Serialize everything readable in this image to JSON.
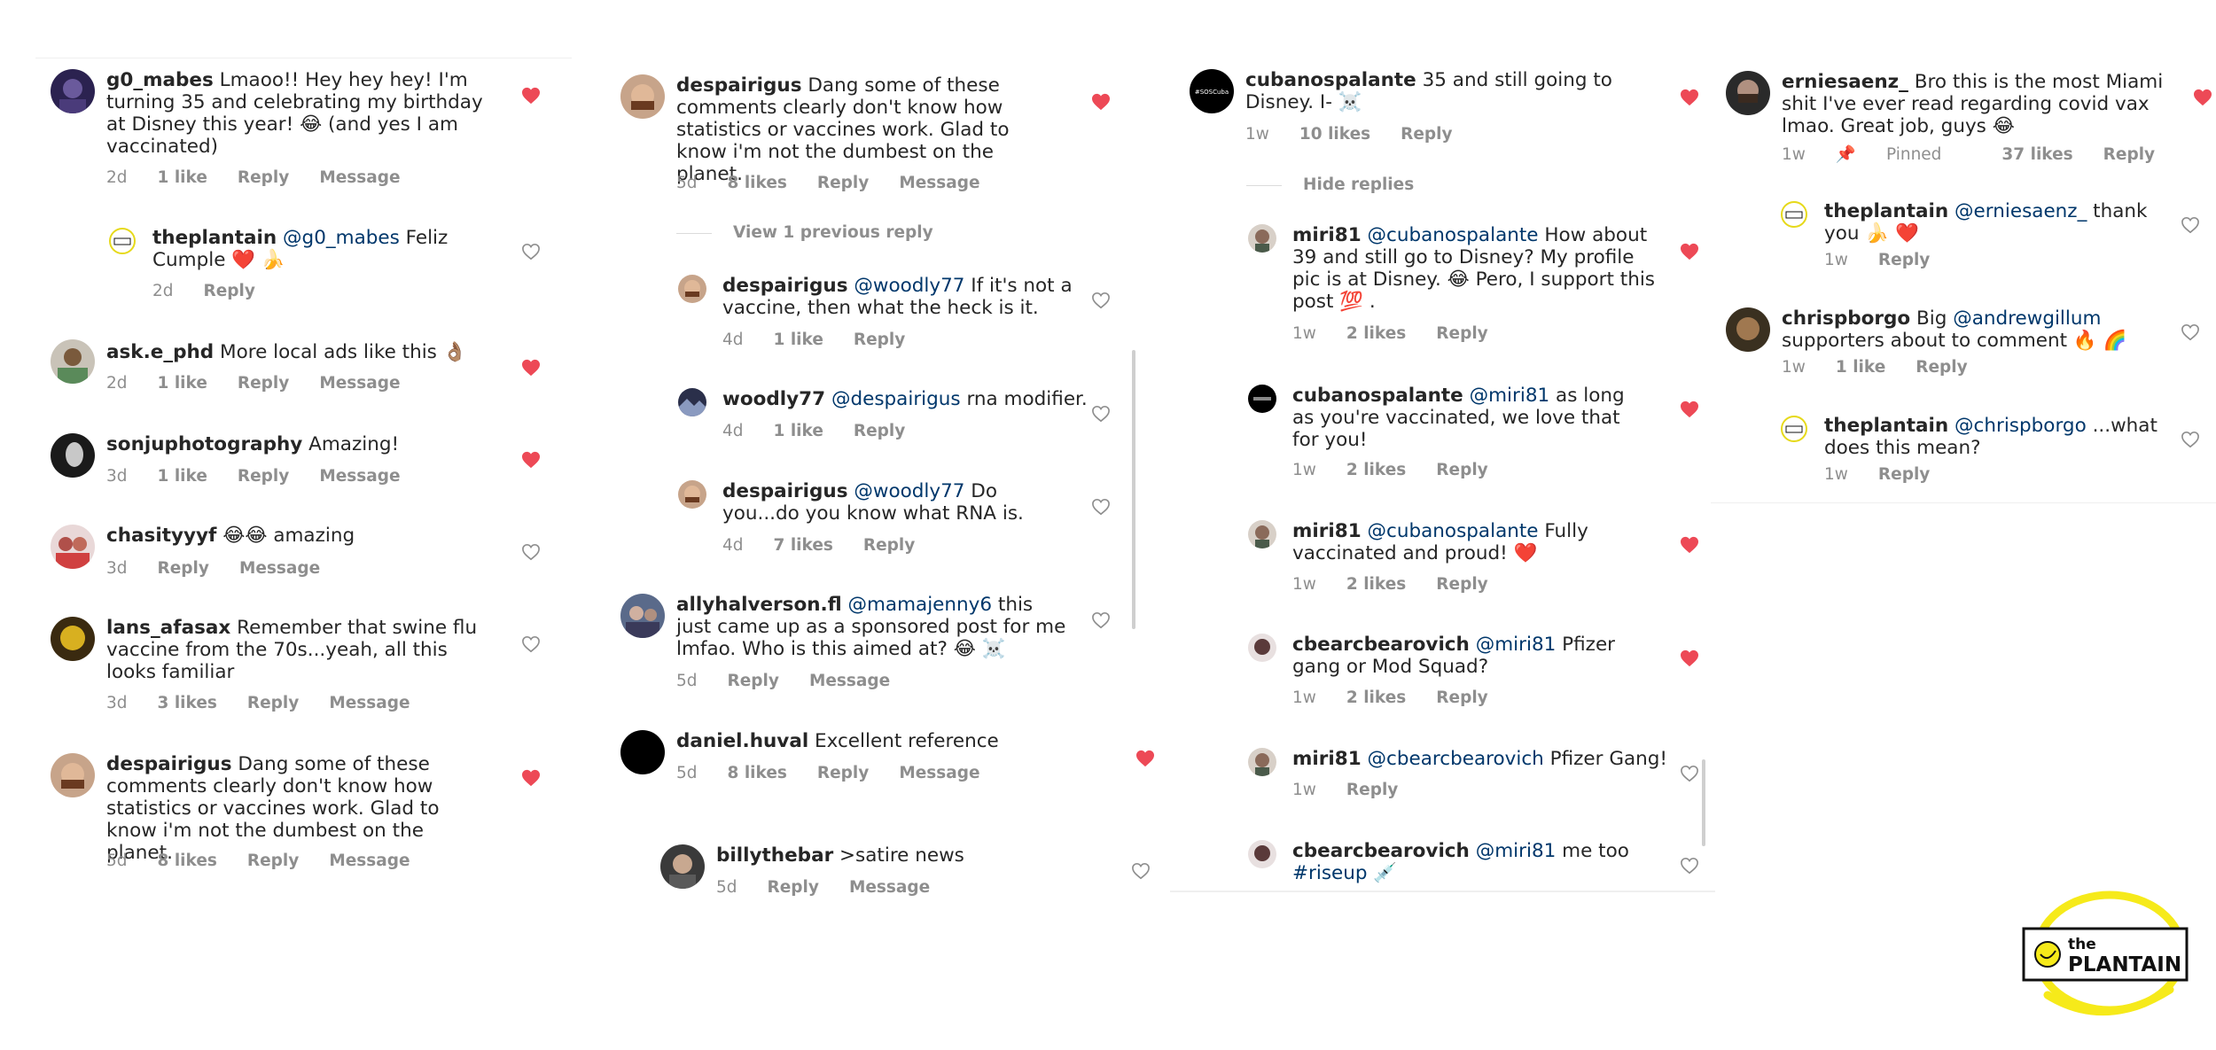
{
  "colors": {
    "heart_liked": "#ed4956",
    "mention": "#00376b",
    "meta": "#8e8e8e",
    "logo_yellow": "#f6ea1a"
  },
  "col1": {
    "c1": {
      "user": "g0_mabes",
      "text": " Lmaoo!! Hey hey hey! I'm turning 35 and celebrating my birthday at Disney this year! 😂 (and yes I am vaccinated)",
      "time": "2d",
      "likes": "1 like",
      "reply": "Reply",
      "message": "Message"
    },
    "c1r": {
      "user": "theplantain",
      "mention": "@g0_mabes",
      "text": " Feliz Cumple ❤️ 🍌",
      "time": "2d",
      "reply": "Reply"
    },
    "c2": {
      "user": "ask.e_phd",
      "text": " More local ads like this 👌🏽",
      "time": "2d",
      "likes": "1 like",
      "reply": "Reply",
      "message": "Message"
    },
    "c3": {
      "user": "sonjuphotography",
      "text": " Amazing!",
      "time": "3d",
      "likes": "1 like",
      "reply": "Reply",
      "message": "Message"
    },
    "c4": {
      "user": "chasityyyf",
      "text": " 😂😂 amazing",
      "time": "3d",
      "reply": "Reply",
      "message": "Message"
    },
    "c5": {
      "user": "lans_afasax",
      "text": " Remember that swine flu vaccine from the 70s...yeah, all this looks familiar",
      "time": "3d",
      "likes": "3 likes",
      "reply": "Reply",
      "message": "Message"
    },
    "c6": {
      "user": "despairigus",
      "text": " Dang some of these comments clearly don't know how statistics or vaccines work. Glad to know i'm not the dumbest on the planet.",
      "time": "5d",
      "likes": "8 likes",
      "reply": "Reply",
      "message": "Message"
    }
  },
  "col2": {
    "c1": {
      "user": "despairigus",
      "text": " Dang some of these comments clearly don't know how statistics or vaccines work. Glad to know i'm not the dumbest on the planet.",
      "time": "5d",
      "likes": "8 likes",
      "reply": "Reply",
      "message": "Message"
    },
    "view_prev": "View 1 previous reply",
    "r1": {
      "user": "despairigus",
      "mention": "@woodly77",
      "text": " If it's not a vaccine, then what the heck is it.",
      "time": "4d",
      "likes": "1 like",
      "reply": "Reply"
    },
    "r2": {
      "user": "woodly77",
      "mention": "@despairigus",
      "text": " rna modifier.",
      "time": "4d",
      "likes": "1 like",
      "reply": "Reply"
    },
    "r3": {
      "user": "despairigus",
      "mention": "@woodly77",
      "text": " Do you...do you know what RNA is.",
      "time": "4d",
      "likes": "7 likes",
      "reply": "Reply"
    },
    "c2": {
      "user": "allyhalverson.fl",
      "mention": "@mamajenny6",
      "text": " this just came up as a sponsored post for me lmfao. Who is this aimed at? 😂 ☠️",
      "time": "5d",
      "reply": "Reply",
      "message": "Message"
    },
    "c3": {
      "user": "daniel.huval",
      "text": " Excellent reference",
      "time": "5d",
      "likes": "8 likes",
      "reply": "Reply",
      "message": "Message"
    },
    "c4": {
      "user": "billythebar",
      "text": " >satire news",
      "time": "5d",
      "reply": "Reply",
      "message": "Message"
    }
  },
  "col3": {
    "c1": {
      "user": "cubanospalante",
      "text": " 35 and still going to Disney. I- ☠️",
      "time": "1w",
      "likes": "10 likes",
      "reply": "Reply",
      "avatar_text": "#SOSCuba"
    },
    "hide_replies": "Hide replies",
    "r1": {
      "user": "miri81",
      "mention": "@cubanospalante",
      "text": " How about 39 and still go to Disney? My profile pic is at Disney. 😂 Pero, I support this post 💯 .",
      "time": "1w",
      "likes": "2 likes",
      "reply": "Reply"
    },
    "r2": {
      "user": "cubanospalante",
      "mention": "@miri81",
      "text": " as long as you're vaccinated, we love that for you!",
      "time": "1w",
      "likes": "2 likes",
      "reply": "Reply"
    },
    "r3": {
      "user": "miri81",
      "mention": "@cubanospalante",
      "text": " Fully vaccinated and proud! ❤️",
      "time": "1w",
      "likes": "2 likes",
      "reply": "Reply"
    },
    "r4": {
      "user": "cbearcbearovich",
      "mention": "@miri81",
      "text": " Pfizer gang or Mod Squad?",
      "time": "1w",
      "likes": "2 likes",
      "reply": "Reply"
    },
    "r5": {
      "user": "miri81",
      "mention": "@cbearcbearovich",
      "text": " Pfizer Gang!",
      "time": "1w",
      "reply": "Reply"
    },
    "r6": {
      "user": "cbearcbearovich",
      "mention": "@miri81",
      "text": " me too ",
      "hashtag": "#riseup",
      "emoji": "💉"
    }
  },
  "col4": {
    "c1": {
      "user": "erniesaenz_",
      "text": " Bro this is the most Miami shit I've ever read regarding covid vax lmao. Great job, guys 😂",
      "time": "1w",
      "pinned": "Pinned",
      "likes": "37 likes",
      "reply": "Reply"
    },
    "r1": {
      "user": "theplantain",
      "mention": "@erniesaenz_",
      "text": " thank you 🍌 ❤️",
      "time": "1w",
      "reply": "Reply"
    },
    "c2": {
      "user": "chrispborgo",
      "text": " Big ",
      "mention": "@andrewgillum",
      "text2": " supporters about to comment 🔥 🌈",
      "time": "1w",
      "likes": "1 like",
      "reply": "Reply"
    },
    "r2": {
      "user": "theplantain",
      "mention": "@chrispborgo",
      "text": " ...what does this mean?",
      "time": "1w",
      "reply": "Reply"
    }
  },
  "logo": {
    "line1": "the",
    "line2": "PLANTAIN"
  }
}
